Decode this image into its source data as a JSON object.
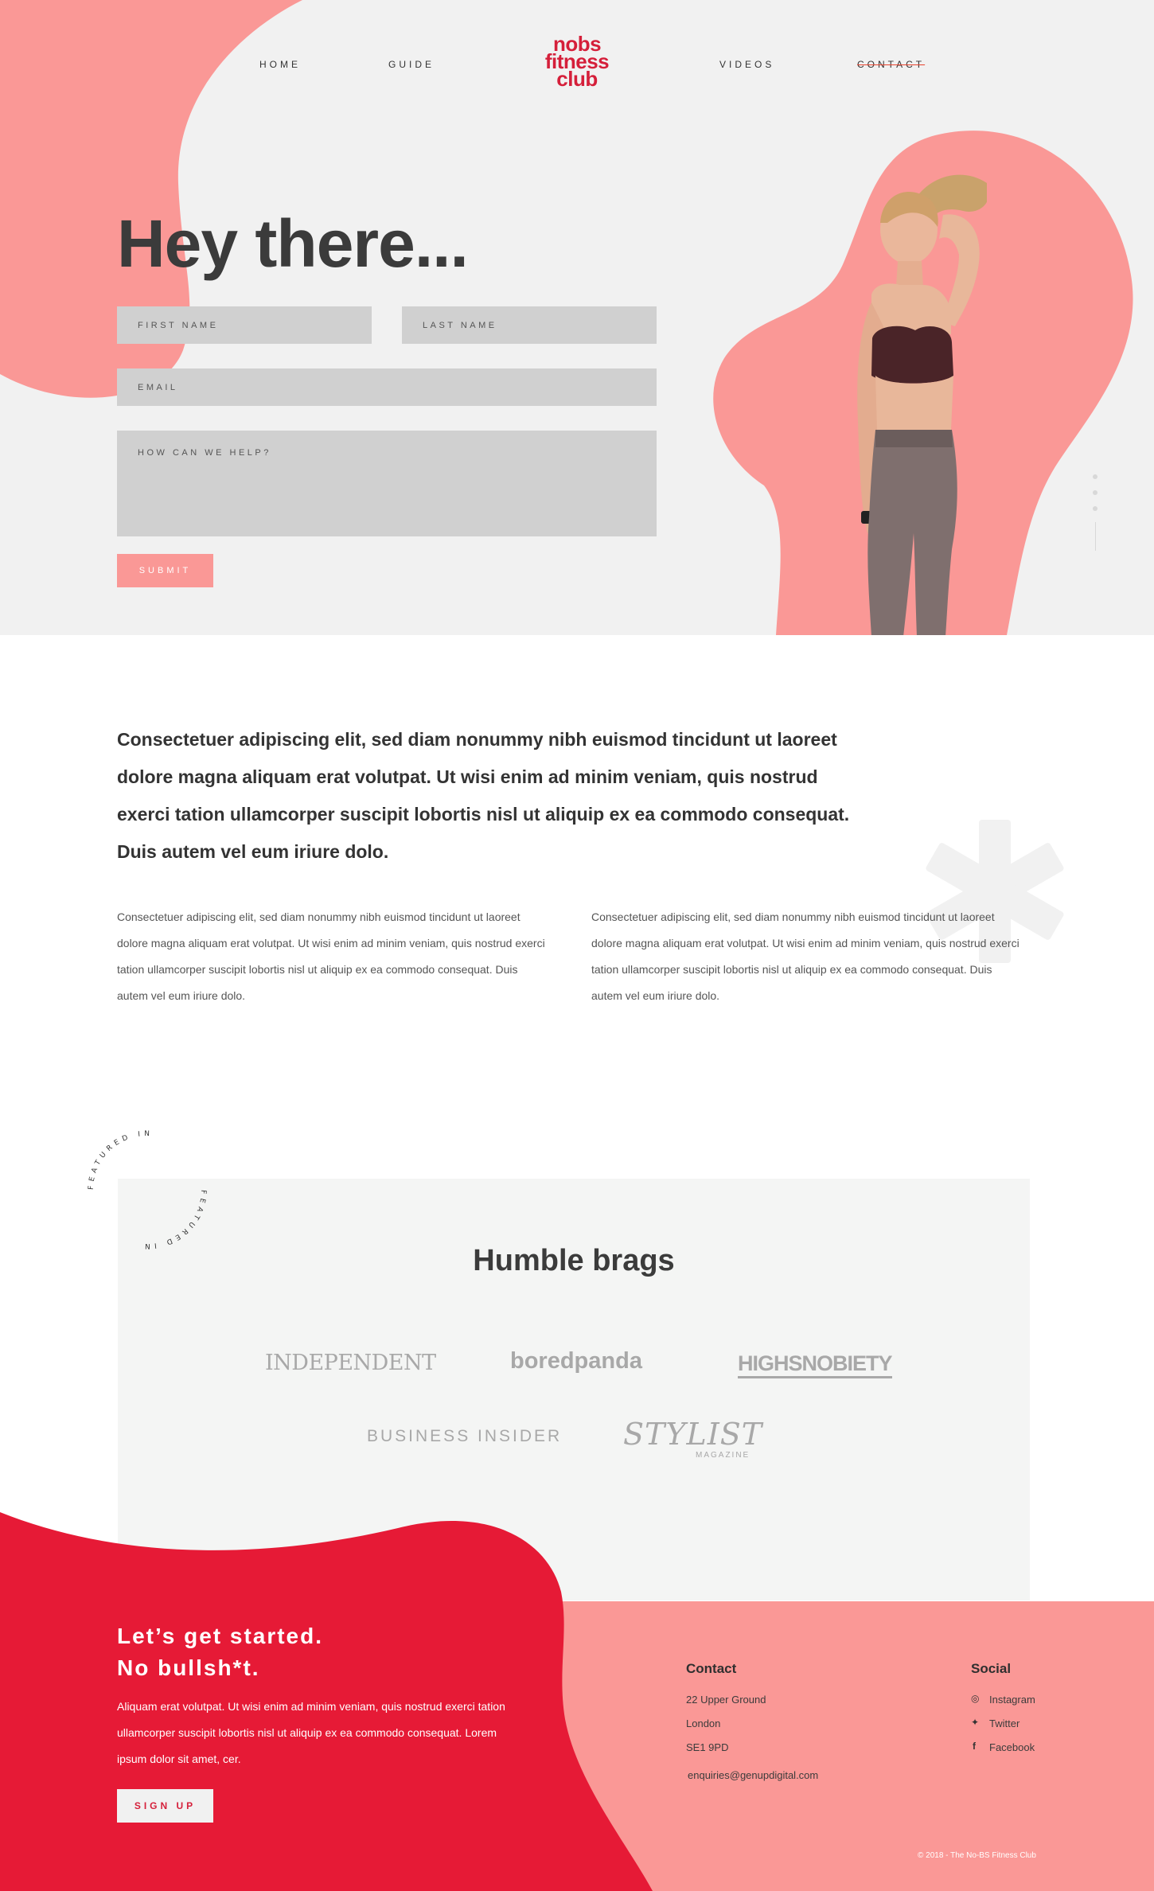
{
  "nav": {
    "links": [
      "HOME",
      "GUIDE",
      "VIDEOS",
      "CONTACT"
    ],
    "logo": [
      "nobs",
      "fitness",
      "club"
    ]
  },
  "hero": {
    "title": "Hey there...",
    "form": {
      "first_name_placeholder": "FIRST NAME",
      "last_name_placeholder": "LAST NAME",
      "email_placeholder": "EMAIL",
      "message_placeholder": "HOW CAN WE HELP?",
      "submit_label": "SUBMIT"
    }
  },
  "intro": {
    "lead": "Consectetuer adipiscing elit, sed diam nonummy nibh euismod tincidunt ut laoreet dolore magna aliquam erat volutpat. Ut wisi enim ad minim veniam, quis nostrud exerci tation ullamcorper suscipit lobortis nisl ut aliquip ex ea commodo consequat. Duis autem vel eum iriure dolo.",
    "col1": "Consectetuer adipiscing elit, sed diam nonummy nibh euismod tincidunt ut laoreet dolore magna aliquam erat volutpat. Ut wisi enim ad minim veniam, quis nostrud exerci tation ullamcorper suscipit lobortis nisl ut aliquip ex ea commodo consequat. Duis autem vel eum iriure dolo.",
    "col2": "Consectetuer adipiscing elit, sed diam nonummy nibh euismod tincidunt ut laoreet dolore magna aliquam erat volutpat. Ut wisi enim ad minim veniam, quis nostrud exerci tation ullamcorper suscipit lobortis nisl ut aliquip ex ea commodo consequat. Duis autem vel eum iriure dolo."
  },
  "brags": {
    "title": "Humble brags",
    "featured_badge": "FEATURED IN",
    "press": [
      "INDEPENDENT",
      "boredpanda",
      "HIGHSNOBIETY",
      "BUSINESS INSIDER",
      "STYLIST",
      "MAGAZINE"
    ]
  },
  "footer": {
    "headline_1": "Let’s get started.",
    "headline_2": "No bullsh*t.",
    "body": "Aliquam erat volutpat. Ut wisi enim ad minim veniam, quis nostrud exerci tation ullamcorper suscipit lobortis nisl ut aliquip ex ea commodo consequat. Lorem ipsum dolor sit amet, cer.",
    "signup_label": "SIGN UP",
    "contact": {
      "title": "Contact",
      "lines": [
        "22 Upper Ground",
        "London",
        "SE1 9PD"
      ],
      "email": "enquiries@genupdigital.com"
    },
    "social": {
      "title": "Social",
      "items": [
        "Instagram",
        "Twitter",
        "Facebook"
      ]
    },
    "copyright": "© 2018 - The No-BS Fitness Club"
  },
  "colors": {
    "coral": "#fa9896",
    "red": "#e61a36",
    "logo_red": "#d51f3a",
    "hero_bg": "#f1f1f1",
    "field_bg": "#d0d0d0",
    "panel_bg": "#f4f5f4"
  },
  "icons": [
    "instagram-icon",
    "twitter-icon",
    "facebook-icon",
    "asterisk-icon",
    "featured-in-badge-icon"
  ]
}
